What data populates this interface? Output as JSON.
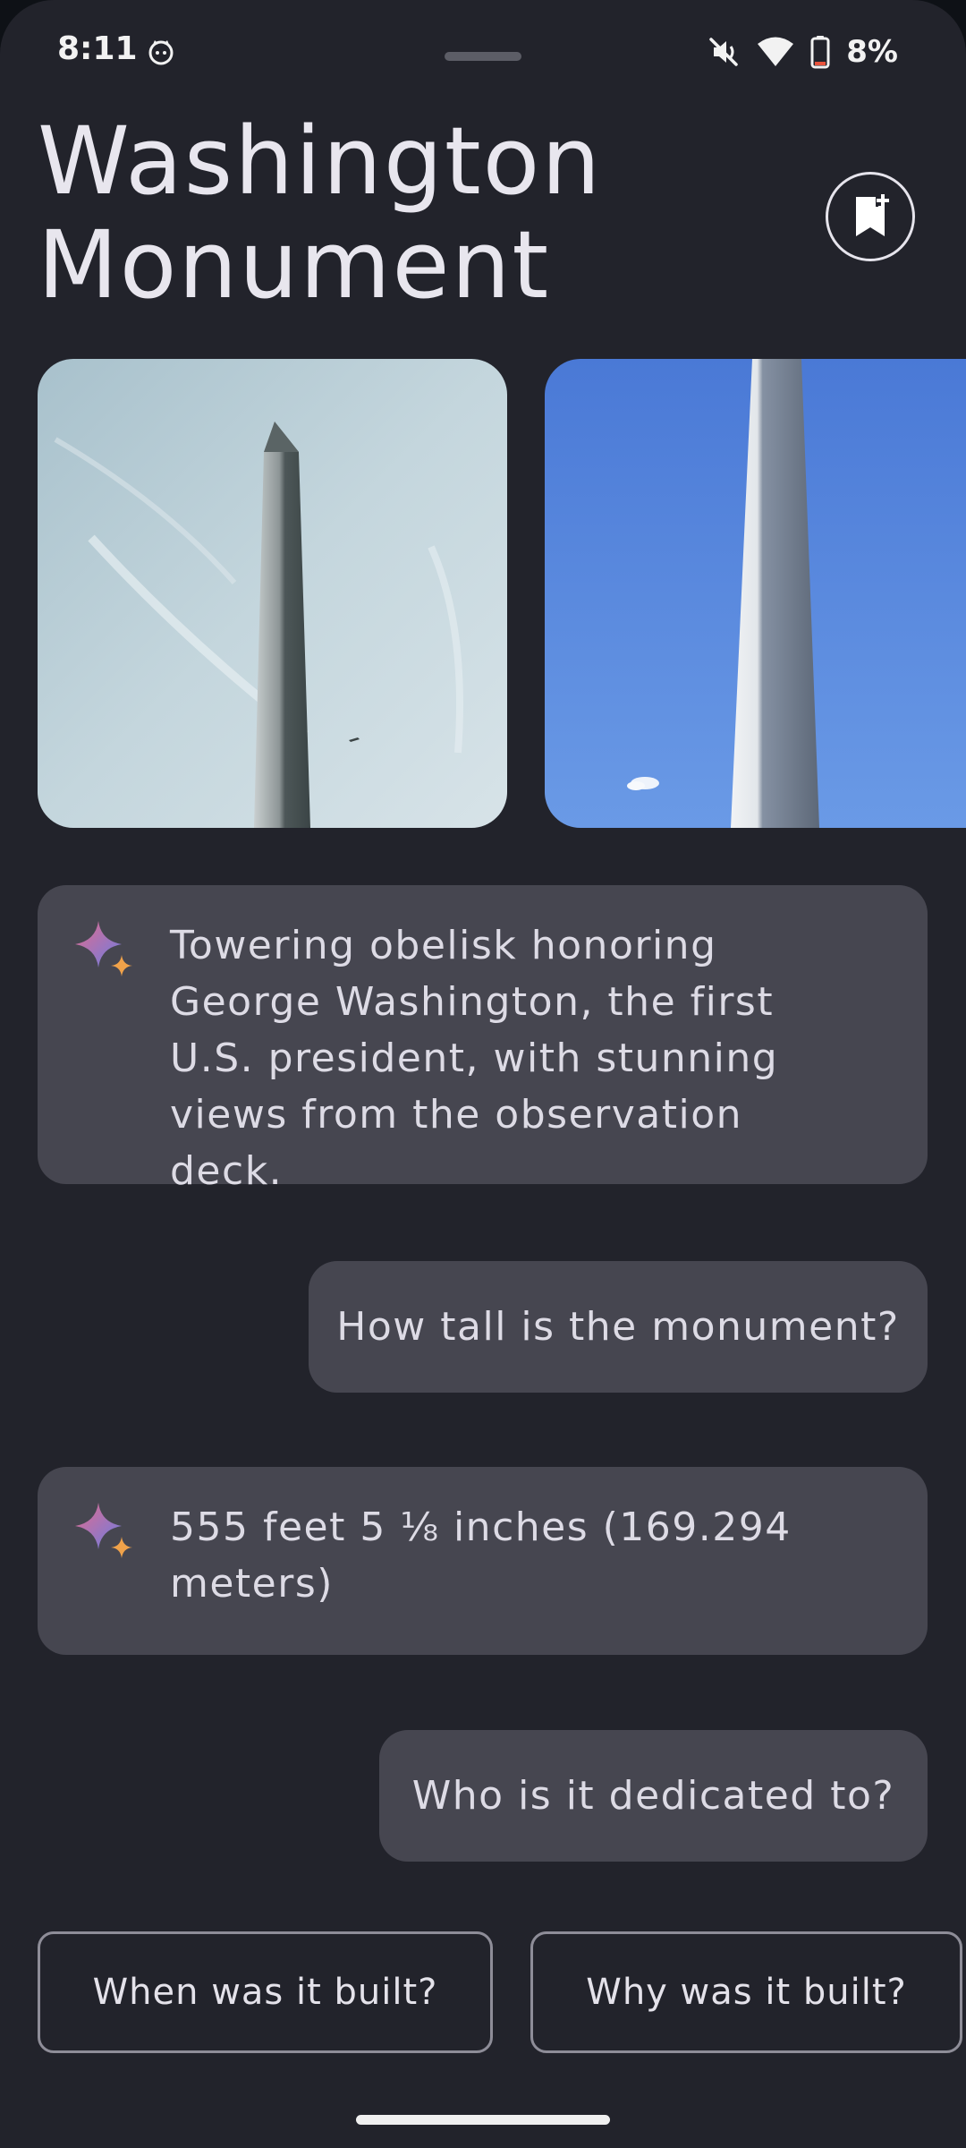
{
  "status_bar": {
    "time": "8:11",
    "app_icon": "cat-face-icon",
    "mute_icon": "vibrate-off-icon",
    "wifi_icon": "wifi-icon",
    "battery_icon": "battery-low-icon",
    "battery_percent": "8%",
    "battery_level": 0.08
  },
  "header": {
    "title_line1": "Washington",
    "title_line2": "Monument",
    "bookmark_icon": "bookmark-add-icon"
  },
  "photos": [
    {
      "name": "monument-photo-hazy-sky",
      "sky": "#b9cdd6"
    },
    {
      "name": "monument-photo-blue-sky",
      "sky": "#4f84dc"
    }
  ],
  "conversation": {
    "summary": "Towering obelisk honoring George Washington, the first U.S. president, with stunning views from the observation deck.",
    "question_1": "How tall is the monument?",
    "answer_1": "555 feet 5 ⅛ inches (169.294 meters)",
    "question_2": "Who is it dedicated to?"
  },
  "suggestions": {
    "chip_1": "When was it built?",
    "chip_2": "Why was it built?"
  },
  "colors": {
    "background": "#22232b",
    "bubble": "#464650",
    "chip_border": "#8e8d98",
    "sparkle_gradient": [
      "#e06a8a",
      "#6d7ee0"
    ],
    "sparkle_accent": "#f0a24a"
  }
}
